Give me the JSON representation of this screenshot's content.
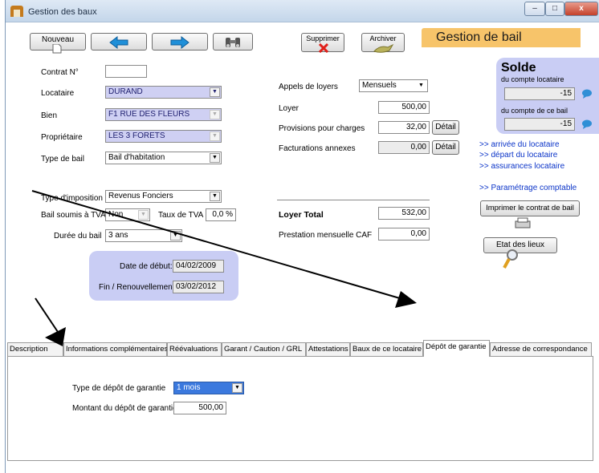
{
  "window": {
    "title": "Gestion des baux",
    "controls": {
      "minimize": "–",
      "maximize": "□",
      "close": "x"
    }
  },
  "toolbar": {
    "new_label": "Nouveau",
    "prev_icon": "arrow-left-icon",
    "next_icon": "arrow-right-icon",
    "search_icon": "binoculars-icon",
    "delete_label": "Supprimer",
    "archive_label": "Archiver",
    "banner": "Gestion de bail"
  },
  "form": {
    "contrat_label": "Contrat N°",
    "contrat_value": "",
    "locataire_label": "Locataire",
    "locataire_value": "DURAND",
    "bien_label": "Bien",
    "bien_value": "F1 RUE DES FLEURS",
    "proprietaire_label": "Propriétaire",
    "proprietaire_value": "LES 3 FORETS",
    "type_bail_label": "Type de bail",
    "type_bail_value": "Bail d'habitation",
    "type_imposition_label": "Type d'imposition",
    "type_imposition_value": "Revenus Fonciers",
    "tva_label": "Bail soumis à TVA",
    "tva_value": "Non",
    "taux_tva_label": "Taux de TVA",
    "taux_tva_value": "0,0 %",
    "duree_label": "Durée du bail",
    "duree_value": "3 ans",
    "date_debut_label": "Date de début:",
    "date_debut_value": "04/02/2009",
    "fin_label": "Fin / Renouvellement:",
    "fin_value": "03/02/2012"
  },
  "loyer": {
    "appels_label": "Appels de loyers",
    "appels_value": "Mensuels",
    "loyer_label": "Loyer",
    "loyer_value": "500,00",
    "provisions_label": "Provisions pour charges",
    "provisions_value": "32,00",
    "facturations_label": "Facturations annexes",
    "facturations_value": "0,00",
    "detail_label": "Détail",
    "total_label": "Loyer Total",
    "total_value": "532,00",
    "caf_label": "Prestation mensuelle CAF",
    "caf_value": "0,00"
  },
  "solde": {
    "title": "Solde",
    "compte_locataire_label": "du compte locataire",
    "compte_locataire_value": "-15",
    "compte_bail_label": "du compte de ce bail",
    "compte_bail_value": "-15"
  },
  "links": {
    "arrivee": ">> arrivée du locataire",
    "depart": ">> départ du locataire",
    "assurances": ">> assurances locataire",
    "parametrage": ">> Paramétrage comptable"
  },
  "actions": {
    "imprimer_label": "Imprimer le contrat de bail",
    "etat_label": "Etat des lieux"
  },
  "tabs": [
    {
      "label": "Description"
    },
    {
      "label": "Informations complémentaires"
    },
    {
      "label": "Réévaluations"
    },
    {
      "label": "Garant / Caution / GRL"
    },
    {
      "label": "Attestations"
    },
    {
      "label": "Baux de ce locataire"
    },
    {
      "label": "Dépôt de garantie"
    },
    {
      "label": "Adresse de correspondance"
    }
  ],
  "depot": {
    "type_label": "Type de dépôt de garantie",
    "type_value": "1 mois",
    "montant_label": "Montant du dépôt de garantie",
    "montant_value": "500,00"
  },
  "colors": {
    "banner": "#f7c46a",
    "lilac_panel": "#c9cdf4",
    "field_lilac": "#cfd0f3",
    "link": "#0b34c8",
    "selection": "#3b79de"
  }
}
